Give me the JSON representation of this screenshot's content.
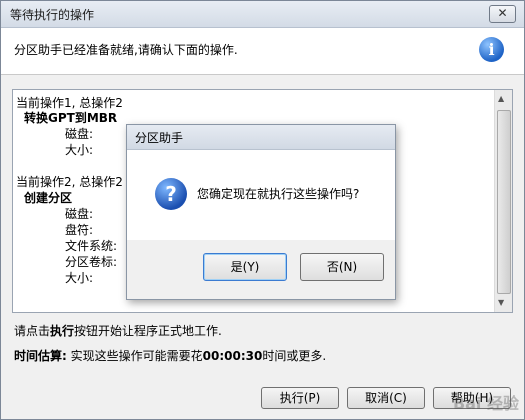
{
  "window": {
    "title": "等待执行的操作",
    "close_label": "✕",
    "header_text": "分区助手已经准备就绪,请确认下面的操作.",
    "info_icon": "i"
  },
  "operations": {
    "op1_header": "当前操作1, 总操作2",
    "op1_title": "转换GPT到MBR",
    "op1_disk_label": "磁盘:",
    "op1_size_label": "大小:",
    "op2_header": "当前操作2, 总操作2",
    "op2_title": "创建分区",
    "op2_disk_label": "磁盘:",
    "op2_letter_label": "盘符:",
    "op2_fs_label": "文件系统:",
    "op2_volume_label": "分区卷标:",
    "op2_size_label": "大小:"
  },
  "hint": {
    "before": "请点击",
    "bold": "执行",
    "after": "按钮开始让程序正式地工作."
  },
  "estimate": {
    "label": "时间估算:",
    "before": " 实现这些操作可能需要花",
    "time": "00:00:30",
    "after": "时间或更多."
  },
  "buttons": {
    "execute": "执行(P)",
    "cancel": "取消(C)",
    "help": "帮助(H)"
  },
  "modal": {
    "title": "分区助手",
    "question": "您确定现在就执行这些操作吗?",
    "icon": "?",
    "yes": "是(Y)",
    "no": "否(N)"
  },
  "watermark": "Bai 经验"
}
